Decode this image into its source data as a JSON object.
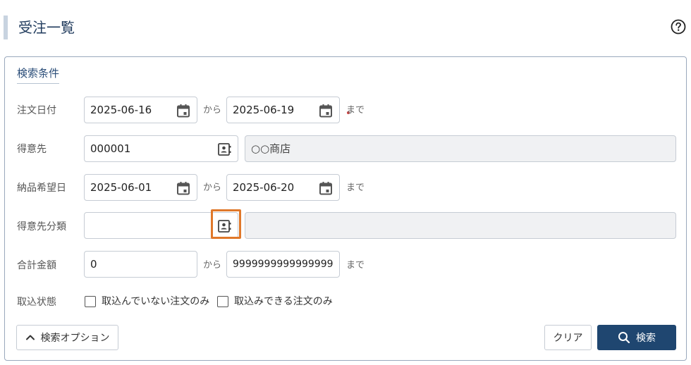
{
  "header": {
    "title": "受注一覧"
  },
  "panel": {
    "title": "検索条件"
  },
  "rows": {
    "order_date": {
      "label": "注文日付",
      "from": "2025-06-16",
      "sep": "から",
      "to": "2025-06-19",
      "suffix": "まで"
    },
    "customer": {
      "label": "得意先",
      "code": "000001",
      "name": "○○商店"
    },
    "delivery_date": {
      "label": "納品希望日",
      "from": "2025-06-01",
      "sep": "から",
      "to": "2025-06-20",
      "suffix": "まで"
    },
    "customer_category": {
      "label": "得意先分類",
      "code": "",
      "name": ""
    },
    "total_amount": {
      "label": "合計金額",
      "from": "0",
      "sep": "から",
      "to": "9999999999999999",
      "suffix": "まで"
    },
    "import_status": {
      "label": "取込状態",
      "option1": "取込んでいない注文のみ",
      "option2": "取込みできる注文のみ"
    }
  },
  "buttons": {
    "options": "検索オプション",
    "clear": "クリア",
    "search": "検索"
  },
  "colors": {
    "accent": "#1f4670",
    "highlight": "#e0782a"
  },
  "icons": {
    "calendar": "calendar-icon",
    "contact": "contact-book-icon",
    "help": "help-icon",
    "search": "search-icon",
    "chevron": "chevron-up-icon"
  }
}
